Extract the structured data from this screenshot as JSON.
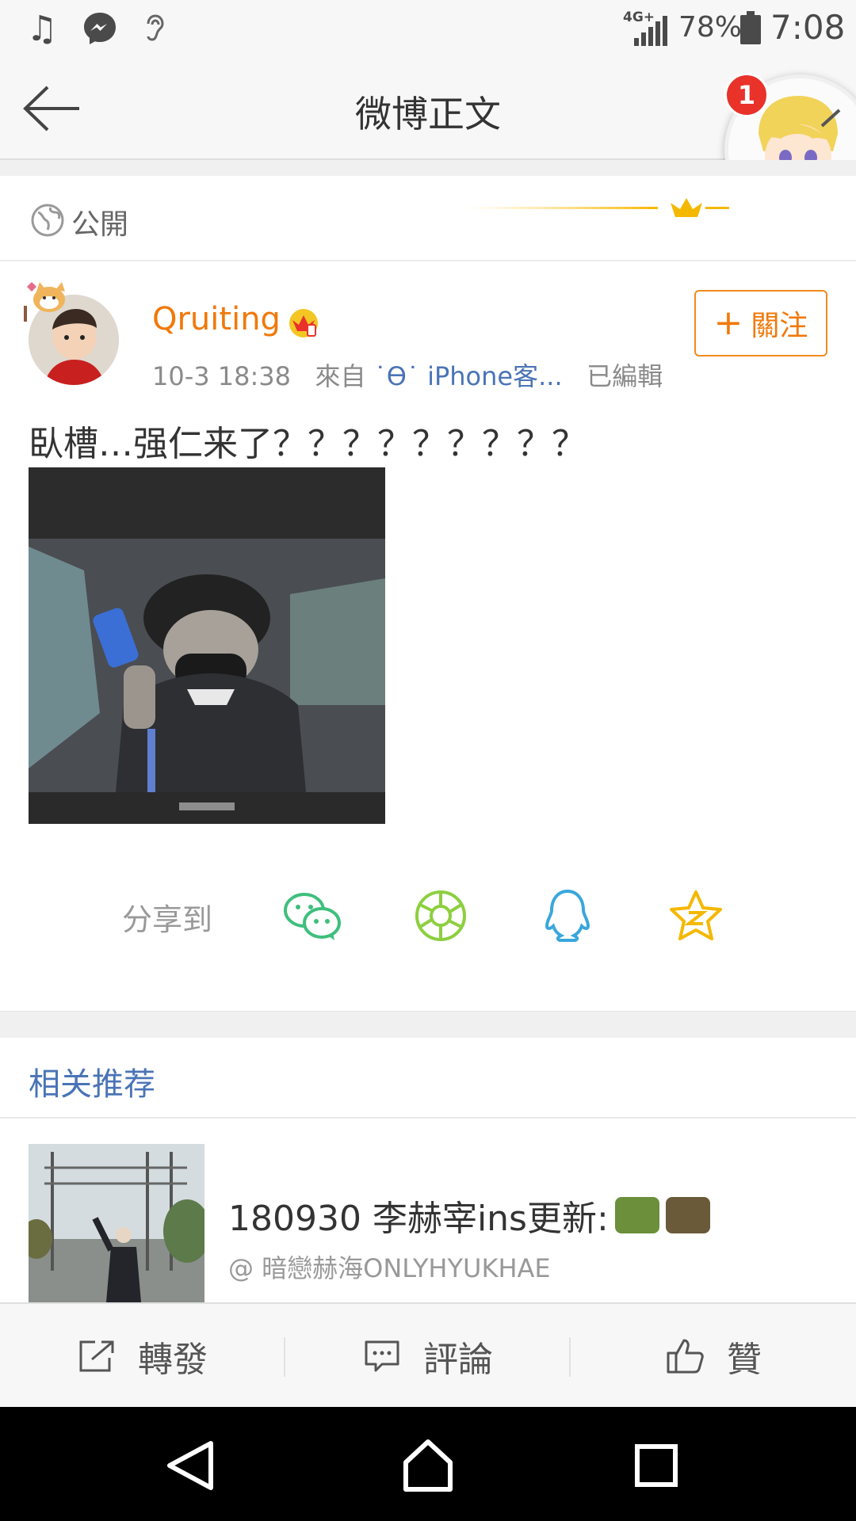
{
  "status_bar": {
    "network": "4G+",
    "battery": "78%",
    "time": "7:08",
    "icons": [
      "music-note-icon",
      "messenger-icon",
      "hearing-icon",
      "signal-icon",
      "battery-icon"
    ]
  },
  "header": {
    "title": "微博正文",
    "notification_count": "1"
  },
  "visibility": {
    "label": "公開"
  },
  "post": {
    "username": "Qruiting",
    "date": "10-3 18:38",
    "source_prefix": "來自",
    "source": "˙ϴ˙ iPhone客...",
    "edited": "已編輯",
    "follow_label": "關注",
    "text": "臥槽…强仁来了？？？？？？？？？"
  },
  "share": {
    "label": "分享到",
    "targets": [
      "wechat-icon",
      "moments-icon",
      "qq-icon",
      "qzone-icon"
    ]
  },
  "recommend": {
    "title": "相关推荐",
    "item_title": "180930 李赫宰ins更新:",
    "item_author": "@ 暗戀赫海ONLYHYUKHAE"
  },
  "actions": {
    "repost": "轉發",
    "comment": "評論",
    "like": "贊"
  },
  "colors": {
    "accent_orange": "#f0790a",
    "link_blue": "#4a74b6",
    "badge_red": "#e8322a"
  }
}
